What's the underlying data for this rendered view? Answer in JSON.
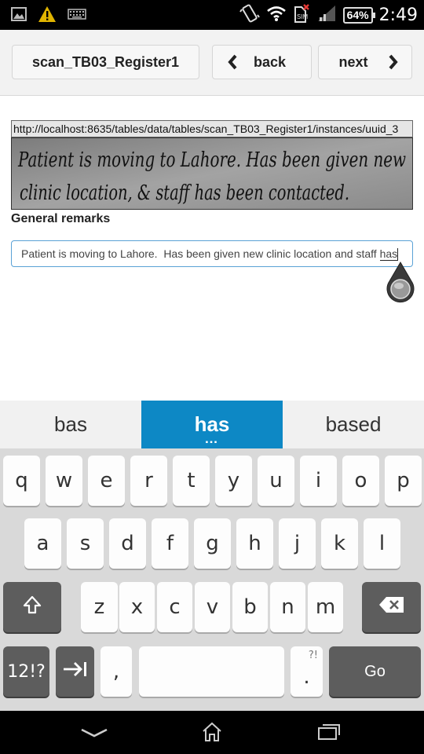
{
  "status_bar": {
    "time": "2:49",
    "battery": "64%",
    "icons": [
      "image-icon",
      "warning-icon",
      "keyboard-icon",
      "vibrate-icon",
      "wifi-icon",
      "sim-error-icon",
      "signal-icon",
      "battery-icon"
    ]
  },
  "header": {
    "title": "scan_TB03_Register1",
    "back_label": "back",
    "next_label": "next"
  },
  "form": {
    "image_url": "http://localhost:8635/tables/data/tables/scan_TB03_Register1/instances/uuid_3",
    "handwriting": "Patient is moving to Lahore. Has been given new clinic location, & staff has been contacted.",
    "field_label": "General remarks",
    "field_value_prefix": "Patient is moving to Lahore.  Has been given new clinic location and staff ",
    "field_value_current_word": "has"
  },
  "suggestions": [
    "bas",
    "has",
    "based"
  ],
  "keyboard": {
    "row1": [
      "q",
      "w",
      "e",
      "r",
      "t",
      "y",
      "u",
      "i",
      "o",
      "p"
    ],
    "row2": [
      "a",
      "s",
      "d",
      "f",
      "g",
      "h",
      "j",
      "k",
      "l"
    ],
    "row3": [
      "z",
      "x",
      "c",
      "v",
      "b",
      "n",
      "m"
    ],
    "symbols_label": "12!?",
    "comma": ",",
    "period": ".",
    "period_alt": "?!",
    "go_label": "Go"
  },
  "colors": {
    "accent": "#0d88c5",
    "status_bar": "#000000",
    "input_border": "#5aa2d6"
  }
}
